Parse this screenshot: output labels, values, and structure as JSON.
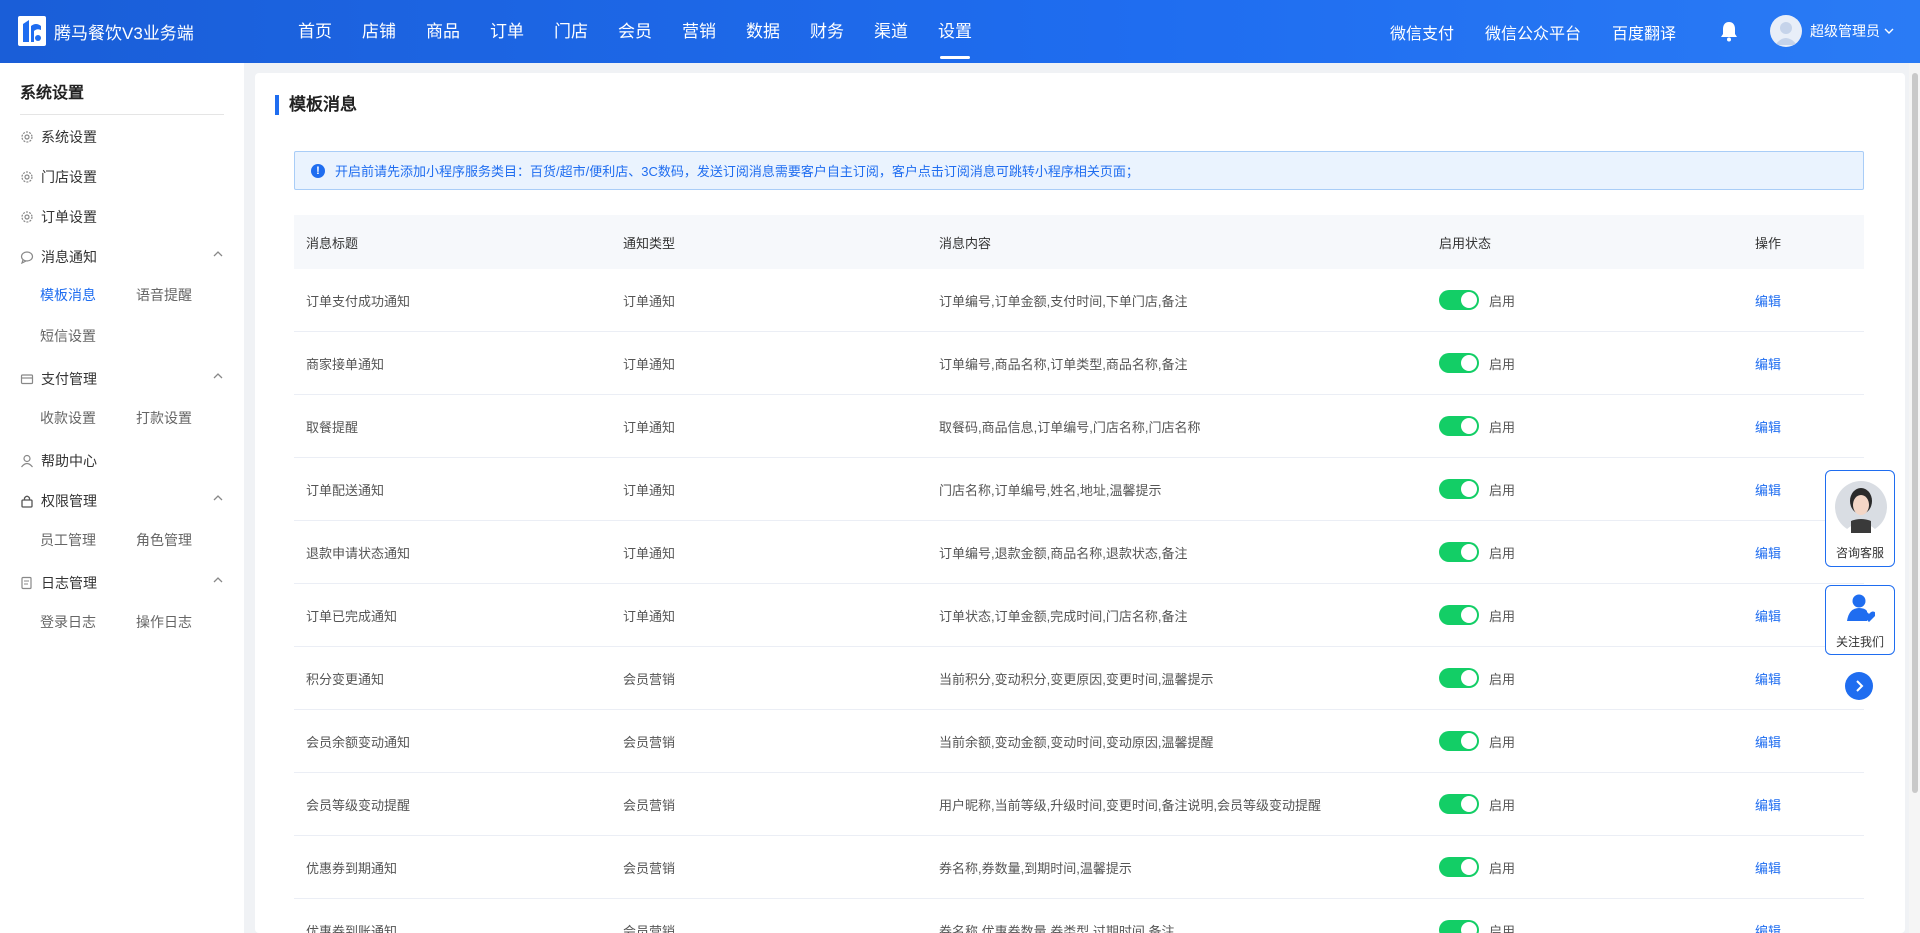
{
  "app": {
    "title": "腾马餐饮V3业务端"
  },
  "nav": [
    "首页",
    "店铺",
    "商品",
    "订单",
    "门店",
    "会员",
    "营销",
    "数据",
    "财务",
    "渠道",
    "设置"
  ],
  "top_links": [
    "微信支付",
    "微信公众平台",
    "百度翻译"
  ],
  "user": {
    "name": "超级管理员"
  },
  "sidebar": {
    "title": "系统设置",
    "items": {
      "system": "系统设置",
      "store": "门店设置",
      "order": "订单设置",
      "message": "消息通知",
      "message_template": "模板消息",
      "message_voice": "语音提醒",
      "message_sms": "短信设置",
      "payment": "支付管理",
      "payment_collect": "收款设置",
      "payment_transfer": "打款设置",
      "help": "帮助中心",
      "permission": "权限管理",
      "permission_staff": "员工管理",
      "permission_role": "角色管理",
      "log": "日志管理",
      "log_login": "登录日志",
      "log_operation": "操作日志"
    }
  },
  "main": {
    "title": "模板消息",
    "notice": "开启前请先添加小程序服务类目：百货/超市/便利店、3C数码，发送订阅消息需要客户自主订阅，客户点击订阅消息可跳转小程序相关页面；",
    "columns": [
      "消息标题",
      "通知类型",
      "消息内容",
      "启用状态",
      "操作"
    ],
    "rows": [
      {
        "title": "订单支付成功通知",
        "type": "订单通知",
        "content": "订单编号,订单金额,支付时间,下单门店,备注",
        "status": "启用",
        "action": "编辑"
      },
      {
        "title": "商家接单通知",
        "type": "订单通知",
        "content": "订单编号,商品名称,订单类型,商品名称,备注",
        "status": "启用",
        "action": "编辑"
      },
      {
        "title": "取餐提醒",
        "type": "订单通知",
        "content": "取餐码,商品信息,订单编号,门店名称,门店名称",
        "status": "启用",
        "action": "编辑"
      },
      {
        "title": "订单配送通知",
        "type": "订单通知",
        "content": "门店名称,订单编号,姓名,地址,温馨提示",
        "status": "启用",
        "action": "编辑"
      },
      {
        "title": "退款申请状态通知",
        "type": "订单通知",
        "content": "订单编号,退款金额,商品名称,退款状态,备注",
        "status": "启用",
        "action": "编辑"
      },
      {
        "title": "订单已完成通知",
        "type": "订单通知",
        "content": "订单状态,订单金额,完成时间,门店名称,备注",
        "status": "启用",
        "action": "编辑"
      },
      {
        "title": "积分变更通知",
        "type": "会员营销",
        "content": "当前积分,变动积分,变更原因,变更时间,温馨提示",
        "status": "启用",
        "action": "编辑"
      },
      {
        "title": "会员余额变动通知",
        "type": "会员营销",
        "content": "当前余额,变动金额,变动时间,变动原因,温馨提醒",
        "status": "启用",
        "action": "编辑"
      },
      {
        "title": "会员等级变动提醒",
        "type": "会员营销",
        "content": "用户昵称,当前等级,升级时间,变更时间,备注说明,会员等级变动提醒",
        "status": "启用",
        "action": "编辑"
      },
      {
        "title": "优惠券到期通知",
        "type": "会员营销",
        "content": "券名称,券数量,到期时间,温馨提示",
        "status": "启用",
        "action": "编辑"
      },
      {
        "title": "优惠券到账通知",
        "type": "会员营销",
        "content": "券名称,优惠券数量,券类型,过期时间,备注",
        "status": "启用",
        "action": "编辑"
      }
    ]
  },
  "float": {
    "service": "咨询客服",
    "follow": "关注我们"
  },
  "colors": {
    "primary": "#1f6df0",
    "switch_on": "#13ce66"
  }
}
